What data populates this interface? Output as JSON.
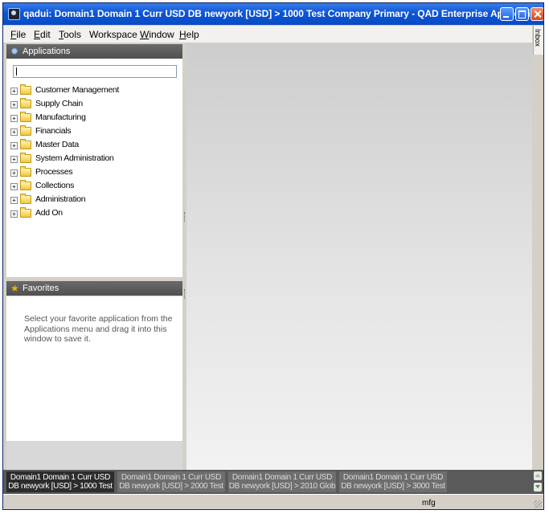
{
  "window": {
    "title": "qadui: Domain1 Domain 1 Curr USD DB newyork [USD] > 1000 Test Company Primary - QAD Enterprise Applications"
  },
  "menubar": {
    "items": [
      {
        "accel": "F",
        "rest": "ile"
      },
      {
        "accel": "E",
        "rest": "dit"
      },
      {
        "accel": "T",
        "rest": "ools"
      },
      {
        "accel": "",
        "rest": "Workspace"
      },
      {
        "accel": "W",
        "rest": "indow"
      },
      {
        "accel": "H",
        "rest": "elp"
      }
    ]
  },
  "inbox": {
    "label": "Inbox"
  },
  "applications": {
    "header": "Applications",
    "search_value": "",
    "items": [
      {
        "label": "Customer Management"
      },
      {
        "label": "Supply Chain"
      },
      {
        "label": "Manufacturing"
      },
      {
        "label": "Financials"
      },
      {
        "label": "Master Data"
      },
      {
        "label": "System Administration"
      },
      {
        "label": "Processes"
      },
      {
        "label": "Collections"
      },
      {
        "label": "Administration"
      },
      {
        "label": "Add On"
      }
    ],
    "expander_symbol": "+"
  },
  "favorites": {
    "header": "Favorites",
    "hint": "Select your favorite application from the Applications menu and drag it into this window to save it."
  },
  "taskbar": {
    "tabs": [
      {
        "line1": "Domain1 Domain 1 Curr USD",
        "line2": "DB newyork [USD] > 1000 Test",
        "active": true
      },
      {
        "line1": "Domain1 Domain 1 Curr USD",
        "line2": "DB newyork [USD] > 2000 Test",
        "active": false
      },
      {
        "line1": "Domain1 Domain 1 Curr USD",
        "line2": "DB newyork [USD] > 2010 Glob",
        "active": false
      },
      {
        "line1": "Domain1 Domain 1 Curr USD",
        "line2": "DB newyork [USD] > 3000 Test",
        "active": false
      }
    ]
  },
  "status": {
    "text": "mfg"
  },
  "icons": {
    "applications_header": "gear-icon",
    "favorites_header": "star-icon",
    "tree_item": "folder-icon"
  },
  "colors": {
    "titlebar": "#0b55d8",
    "panel_header": "#5a5a5a",
    "taskbar_active": "#2c2c2c",
    "taskbar_inactive": "#6e6e6e"
  }
}
